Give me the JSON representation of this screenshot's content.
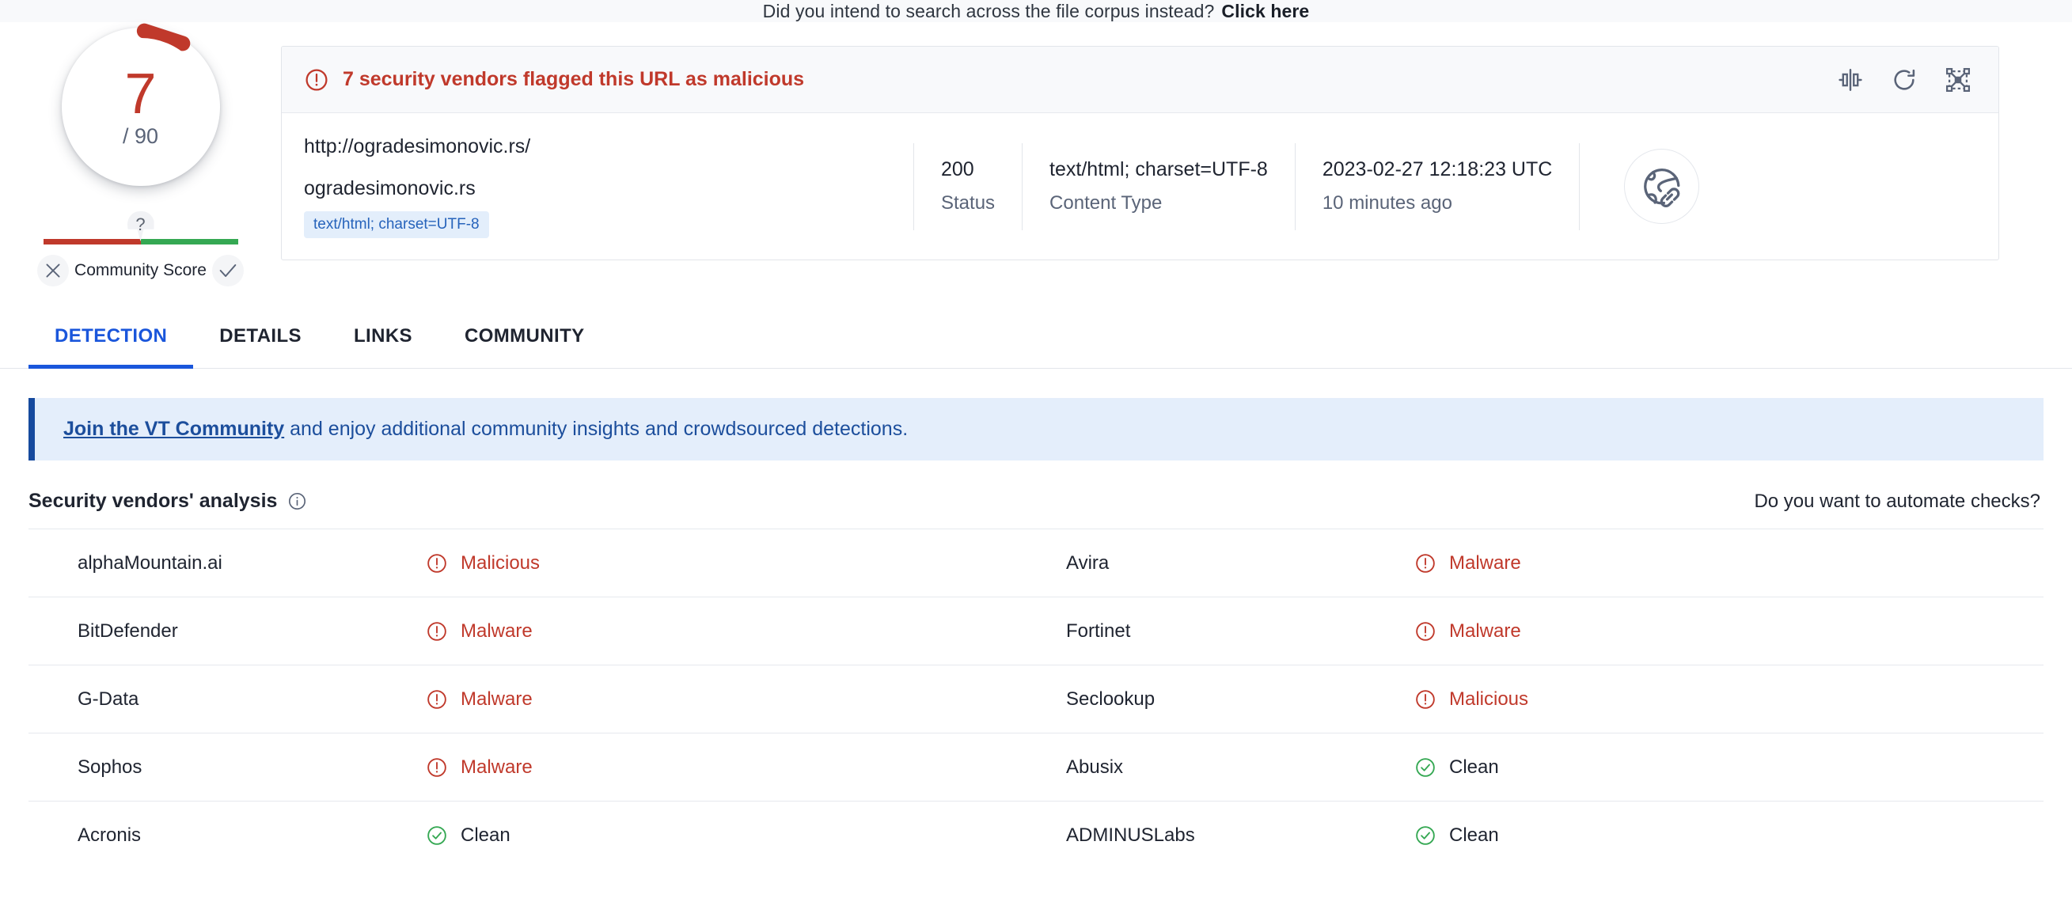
{
  "top_banner": {
    "text": "Did you intend to search across the file corpus instead?",
    "link": "Click here"
  },
  "gauge": {
    "score": "7",
    "total": "/ 90"
  },
  "community_score": {
    "marker": "?",
    "label": "Community Score",
    "negative_icon": "x-icon",
    "positive_icon": "check-icon"
  },
  "alert": {
    "icon": "alert-circle-icon",
    "message": "7 security vendors flagged this URL as malicious"
  },
  "header_actions": [
    {
      "icon": "compare-icon",
      "name": "compare-button"
    },
    {
      "icon": "reanalyze-icon",
      "name": "reanalyze-button"
    },
    {
      "icon": "graph-icon",
      "name": "graph-button"
    }
  ],
  "meta": {
    "url": "http://ogradesimonovic.rs/",
    "domain": "ogradesimonovic.rs",
    "tag": "text/html; charset=UTF-8",
    "status_value": "200",
    "status_label": "Status",
    "content_type_value": "text/html; charset=UTF-8",
    "content_type_label": "Content Type",
    "scan_date": "2023-02-27 12:18:23 UTC",
    "scan_relative": "10 minutes ago",
    "avatar_icon": "globe-link-icon"
  },
  "tabs": [
    {
      "label": "DETECTION",
      "active": true
    },
    {
      "label": "DETAILS",
      "active": false
    },
    {
      "label": "LINKS",
      "active": false
    },
    {
      "label": "COMMUNITY",
      "active": false
    }
  ],
  "join_banner": {
    "link": "Join the VT Community",
    "text": " and enjoy additional community insights and crowdsourced detections."
  },
  "vendors_section": {
    "title": "Security vendors' analysis",
    "info_icon": "info-icon",
    "automate_link": "Do you want to automate checks?"
  },
  "colors": {
    "malicious": "#c0392b",
    "clean": "#35a853",
    "accent": "#1a56db",
    "banner_bg": "#e4eefb"
  },
  "vendor_rows": [
    {
      "left": {
        "name": "alphaMountain.ai",
        "result": "Malicious",
        "status": "malicious"
      },
      "right": {
        "name": "Avira",
        "result": "Malware",
        "status": "malicious"
      }
    },
    {
      "left": {
        "name": "BitDefender",
        "result": "Malware",
        "status": "malicious"
      },
      "right": {
        "name": "Fortinet",
        "result": "Malware",
        "status": "malicious"
      }
    },
    {
      "left": {
        "name": "G-Data",
        "result": "Malware",
        "status": "malicious"
      },
      "right": {
        "name": "Seclookup",
        "result": "Malicious",
        "status": "malicious"
      }
    },
    {
      "left": {
        "name": "Sophos",
        "result": "Malware",
        "status": "malicious"
      },
      "right": {
        "name": "Abusix",
        "result": "Clean",
        "status": "clean"
      }
    },
    {
      "left": {
        "name": "Acronis",
        "result": "Clean",
        "status": "clean"
      },
      "right": {
        "name": "ADMINUSLabs",
        "result": "Clean",
        "status": "clean"
      }
    }
  ]
}
